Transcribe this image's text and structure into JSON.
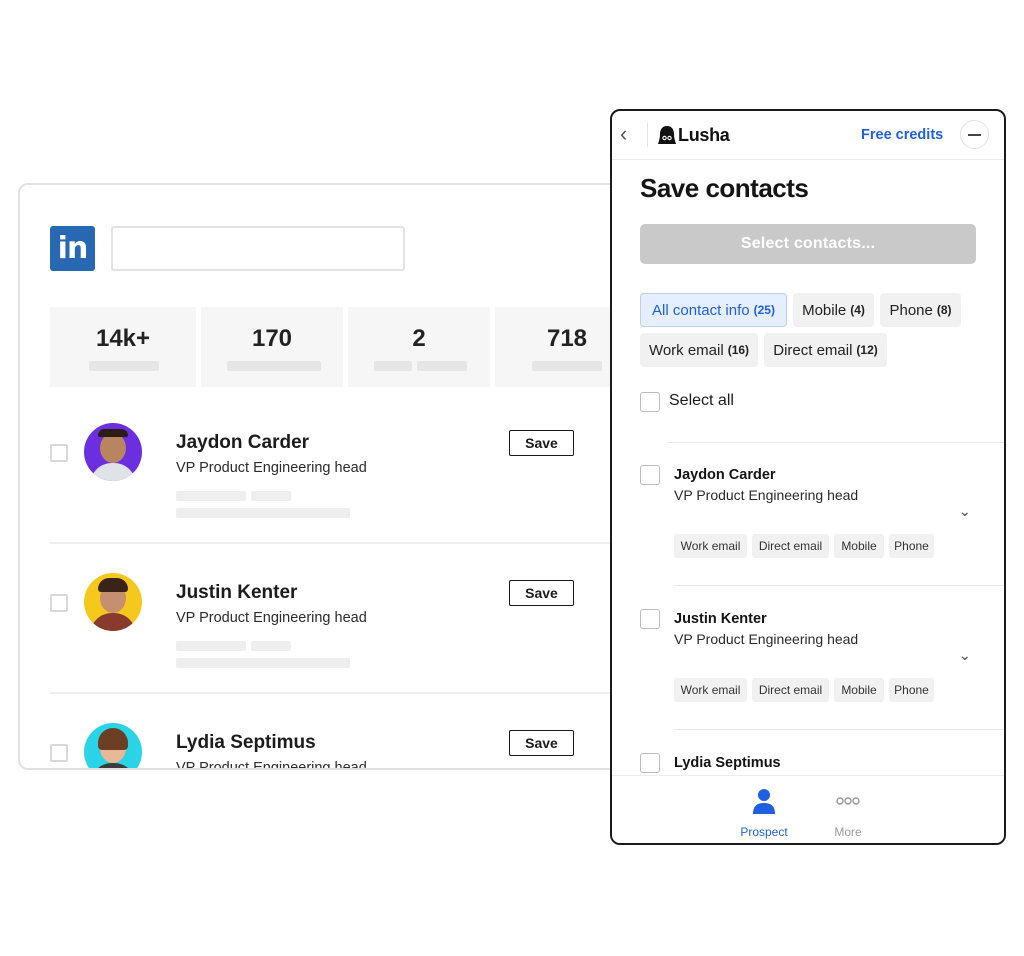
{
  "linkedin": {
    "logo_text": "in",
    "stats": [
      "14k+",
      "170",
      "2",
      "718"
    ],
    "save_label": "Save",
    "profiles": [
      {
        "name": "Jaydon Carder",
        "title": "VP Product Engineering head"
      },
      {
        "name": "Justin Kenter",
        "title": "VP Product Engineering head"
      },
      {
        "name": "Lydia Septimus",
        "title": "VP Product Engineering head"
      }
    ]
  },
  "lusha": {
    "brand": "Lusha",
    "free_credits": "Free credits",
    "title": "Save contacts",
    "select_button": "Select contacts...",
    "filters": [
      {
        "label": "All contact info",
        "count": "(25)"
      },
      {
        "label": "Mobile",
        "count": "(4)"
      },
      {
        "label": "Phone",
        "count": "(8)"
      },
      {
        "label": "Work email",
        "count": "(16)"
      },
      {
        "label": "Direct email",
        "count": "(12)"
      }
    ],
    "select_all": "Select all",
    "contacts": [
      {
        "name": "Jaydon Carder",
        "title": "VP Product Engineering head",
        "tags": [
          "Work email",
          "Direct email",
          "Mobile",
          "Phone"
        ]
      },
      {
        "name": "Justin Kenter",
        "title": "VP Product Engineering head",
        "tags": [
          "Work email",
          "Direct email",
          "Mobile",
          "Phone"
        ]
      },
      {
        "name": "Lydia Septimus"
      }
    ],
    "nav": [
      {
        "label": "Prospect",
        "icon": "person-icon",
        "active": true
      },
      {
        "label": "More",
        "icon": "more-dots-icon",
        "active": false
      }
    ]
  },
  "colors": {
    "accent": "#1f5fe0",
    "linkedin_blue": "#2867b2",
    "avatar_backgrounds": [
      "#6b2fe0",
      "#f4c81c",
      "#2ad3e6"
    ]
  }
}
